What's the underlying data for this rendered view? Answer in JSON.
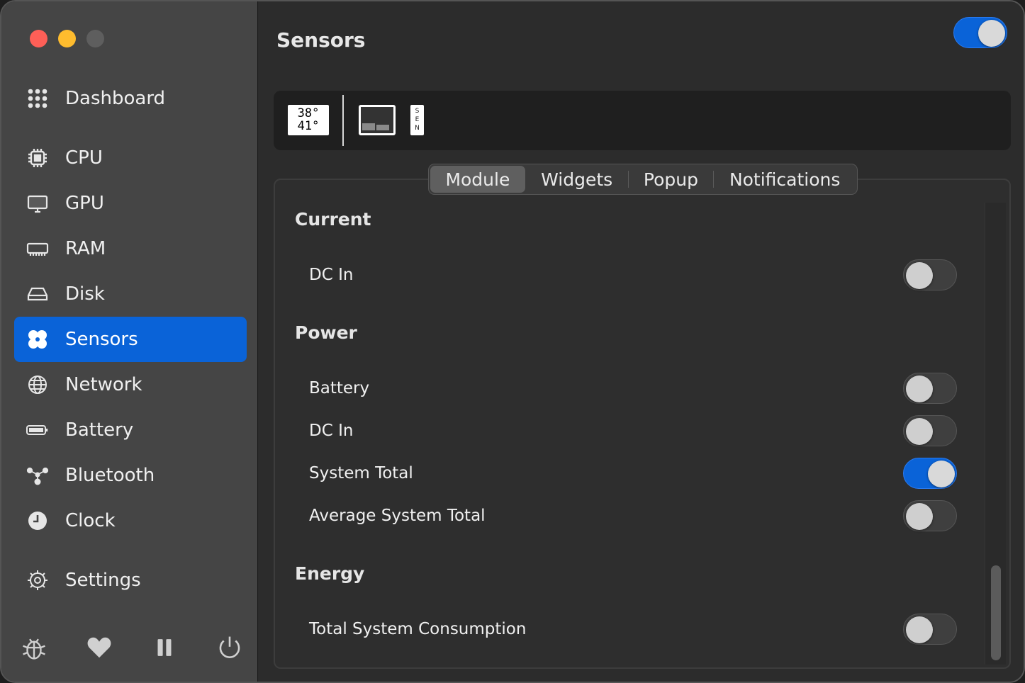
{
  "window": {
    "title": "Sensors",
    "module_enabled": true
  },
  "sidebar": {
    "items": [
      {
        "label": "Dashboard",
        "icon": "grid-icon"
      },
      {
        "label": "CPU",
        "icon": "cpu-icon"
      },
      {
        "label": "GPU",
        "icon": "gpu-icon"
      },
      {
        "label": "RAM",
        "icon": "ram-icon"
      },
      {
        "label": "Disk",
        "icon": "disk-icon"
      },
      {
        "label": "Sensors",
        "icon": "fan-icon",
        "active": true
      },
      {
        "label": "Network",
        "icon": "globe-icon"
      },
      {
        "label": "Battery",
        "icon": "battery-icon"
      },
      {
        "label": "Bluetooth",
        "icon": "bluetooth-icon"
      },
      {
        "label": "Clock",
        "icon": "clock-icon"
      },
      {
        "label": "Settings",
        "icon": "gear-icon"
      }
    ],
    "bottom_icons": [
      "bug-icon",
      "heart-icon",
      "pause-icon",
      "power-icon"
    ]
  },
  "widget_preview": {
    "temp_line1": "38°",
    "temp_line2": "41°",
    "label_widget_letters": [
      "S",
      "E",
      "N"
    ]
  },
  "tabs": [
    {
      "label": "Module",
      "active": true
    },
    {
      "label": "Widgets"
    },
    {
      "label": "Popup"
    },
    {
      "label": "Notifications"
    }
  ],
  "sections": [
    {
      "title": "Current",
      "rows": [
        {
          "label": "DC In",
          "enabled": false
        }
      ]
    },
    {
      "title": "Power",
      "rows": [
        {
          "label": "Battery",
          "enabled": false
        },
        {
          "label": "DC In",
          "enabled": false
        },
        {
          "label": "System Total",
          "enabled": true
        },
        {
          "label": "Average System Total",
          "enabled": false
        }
      ]
    },
    {
      "title": "Energy",
      "rows": [
        {
          "label": "Total System Consumption",
          "enabled": false
        }
      ]
    }
  ],
  "colors": {
    "accent": "#0a63d8",
    "sidebar_bg": "#454545",
    "main_bg": "#2c2c2c"
  }
}
